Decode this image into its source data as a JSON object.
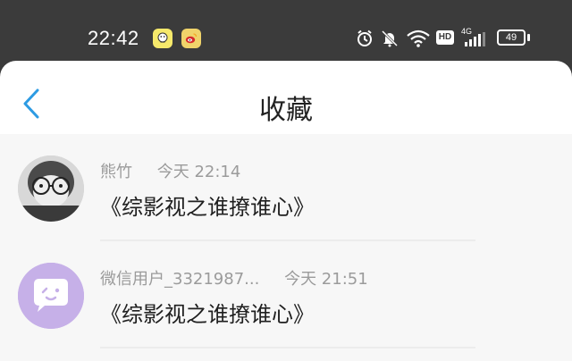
{
  "status_bar": {
    "time": "22:42",
    "network": "4G",
    "hd_label": "HD",
    "battery": "49",
    "apps": [
      "qq-icon",
      "weibo-icon"
    ]
  },
  "nav": {
    "title": "收藏"
  },
  "favorites": [
    {
      "user": "熊竹",
      "time": "今天 22:14",
      "title": "《综影视之谁撩谁心》"
    },
    {
      "user": "微信用户_3321987...",
      "time": "今天 21:51",
      "title": "《综影视之谁撩谁心》"
    }
  ],
  "colors": {
    "status_bg": "#3b3b3b",
    "accent": "#2d9be3",
    "text_primary": "#1f1f1f",
    "text_secondary": "#9b9b9b",
    "page_bg": "#f7f7f7"
  }
}
